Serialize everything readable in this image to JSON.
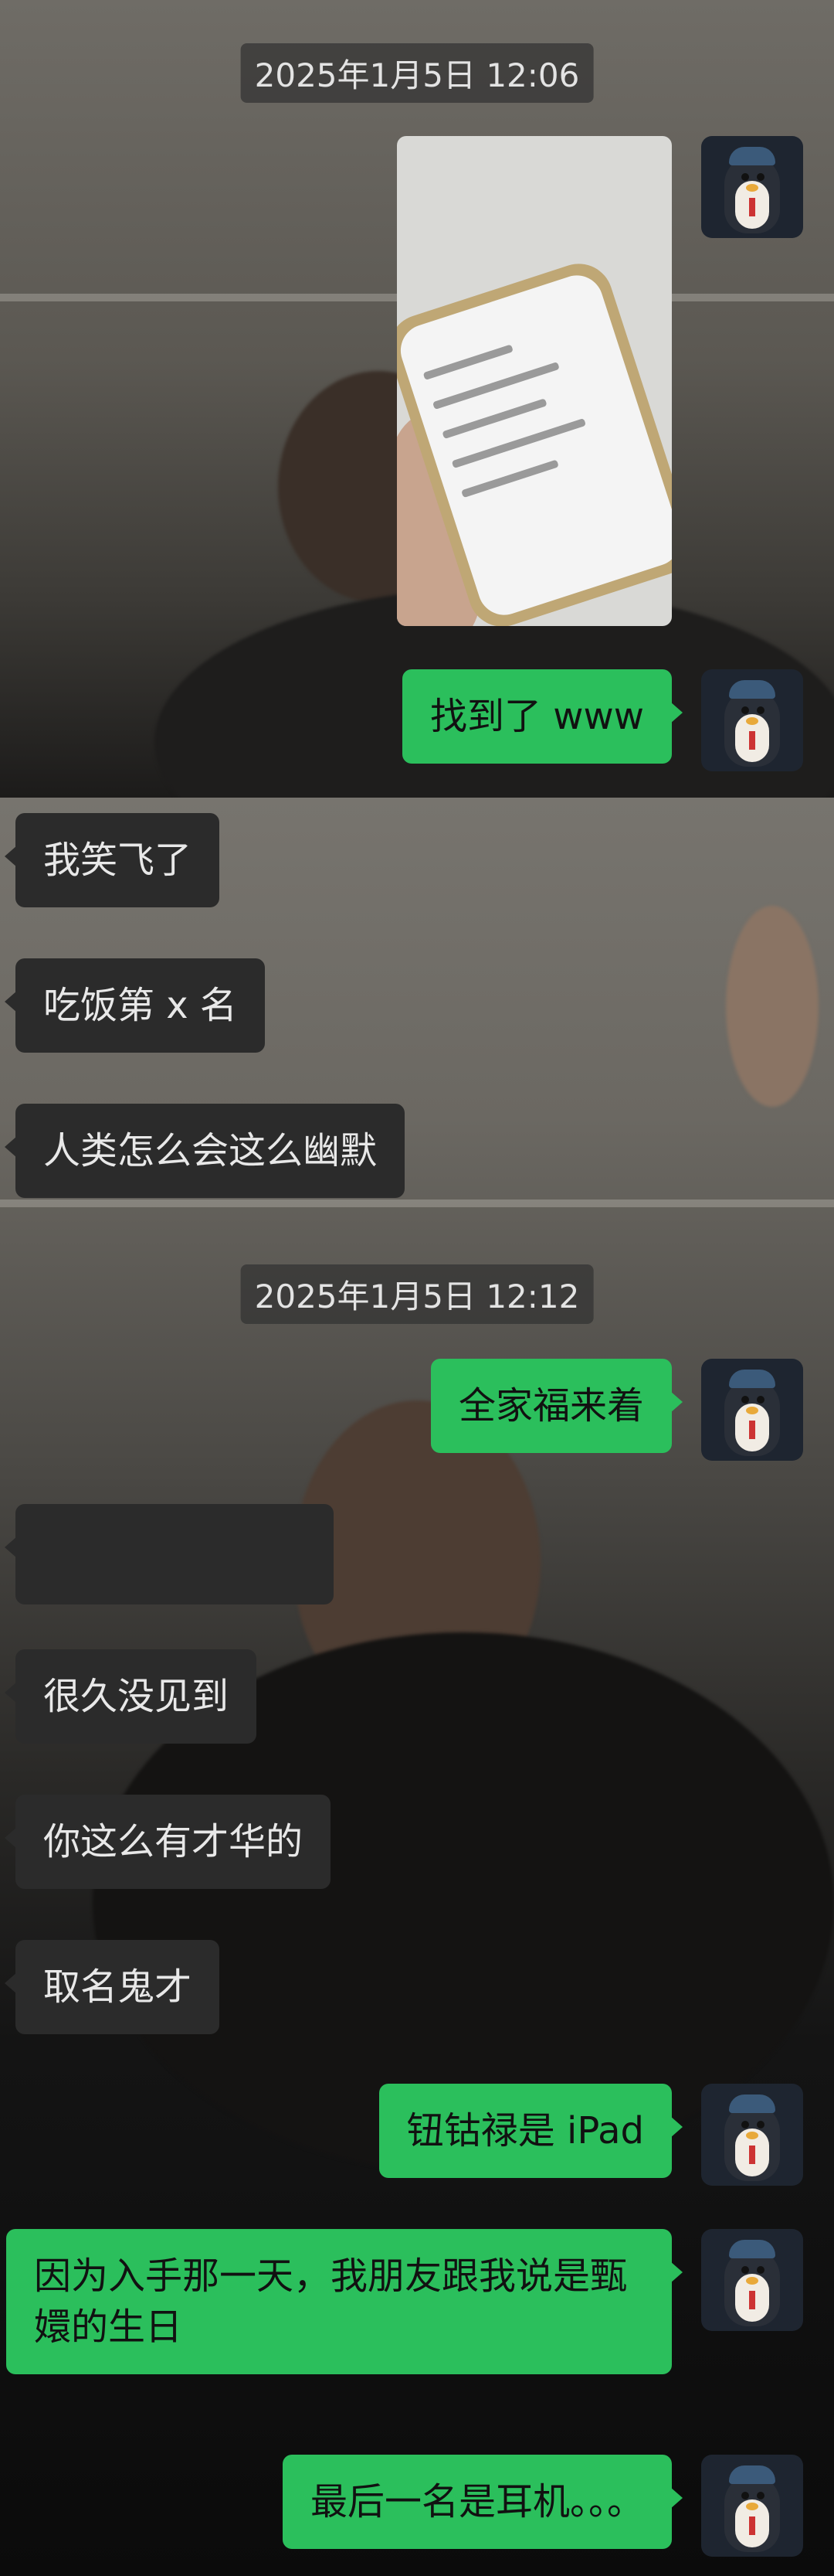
{
  "timestamps": [
    "2025年1月5日 12:06",
    "2025年1月5日 12:12"
  ],
  "messages": {
    "m1": "找到了 www",
    "m2": "我笑飞了",
    "m3": "吃饭第 x 名",
    "m4": "人类怎么会这么幽默",
    "m5": "全家福来着",
    "m6": "",
    "m7": "很久没见到",
    "m8": "你这么有才华的",
    "m9": "取名鬼才",
    "m10": "钮钴禄是 iPad",
    "m11": "因为入手那一天，我朋友跟我说是甄嬛的生日",
    "m12": "最后一名是耳机。。。"
  },
  "colors": {
    "sent_bubble": "#2bbf5c",
    "received_bubble": "#2b2b2b",
    "timestamp_bg": "#323232"
  },
  "icons": {
    "avatar": "penguin-avatar-icon"
  }
}
